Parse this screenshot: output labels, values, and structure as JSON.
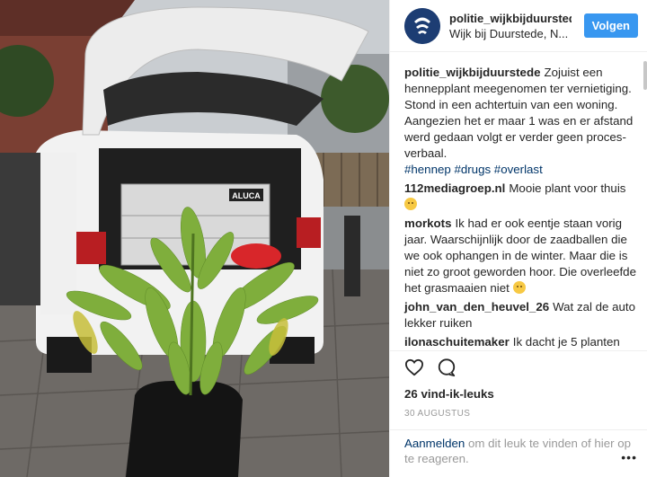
{
  "header": {
    "username": "politie_wijkbijduurstede",
    "location": "Wijk bij Duurstede, N...",
    "follow_label": "Volgen"
  },
  "caption": {
    "username": "politie_wijkbijduurstede",
    "text": "Zojuist een hennepplant meegenomen ter vernietiging. Stond in een achtertuin van een woning. Aangezien het er maar 1 was en er afstand werd gedaan volgt er verder geen proces-verbaal.",
    "hashtags": "#hennep #drugs #overlast"
  },
  "comments": [
    {
      "username": "112mediagroep.nl",
      "text": "Mooie plant voor thuis",
      "emoji": "wink"
    },
    {
      "username": "morkots",
      "text": "Ik had er ook eentje staan vorig jaar. Waarschijnlijk door de zaadballen die we ook ophangen in de winter. Maar die is niet zo groot geworden hoor. Die overleefde het grasmaaien niet",
      "emoji": "grin"
    },
    {
      "username": "john_van_den_heuvel_26",
      "text": "Wat zal de auto lekker ruiken"
    },
    {
      "username": "ilonaschuitemaker",
      "text": "Ik dacht je 5 planten"
    }
  ],
  "actions": {
    "likes": "26 vind-ik-leuks",
    "date": "30 AUGUSTUS",
    "icons": [
      "heart-icon",
      "comment-icon"
    ]
  },
  "footer": {
    "login_label": "Aanmelden",
    "rest": " om dit leuk te vinden of hier op te reageren.",
    "more_label": "•••"
  },
  "photo": {
    "box_brand": "ALUCA"
  },
  "colors": {
    "follow_button": "#3897f0",
    "link": "#003569",
    "avatar": "#1d3d73"
  }
}
